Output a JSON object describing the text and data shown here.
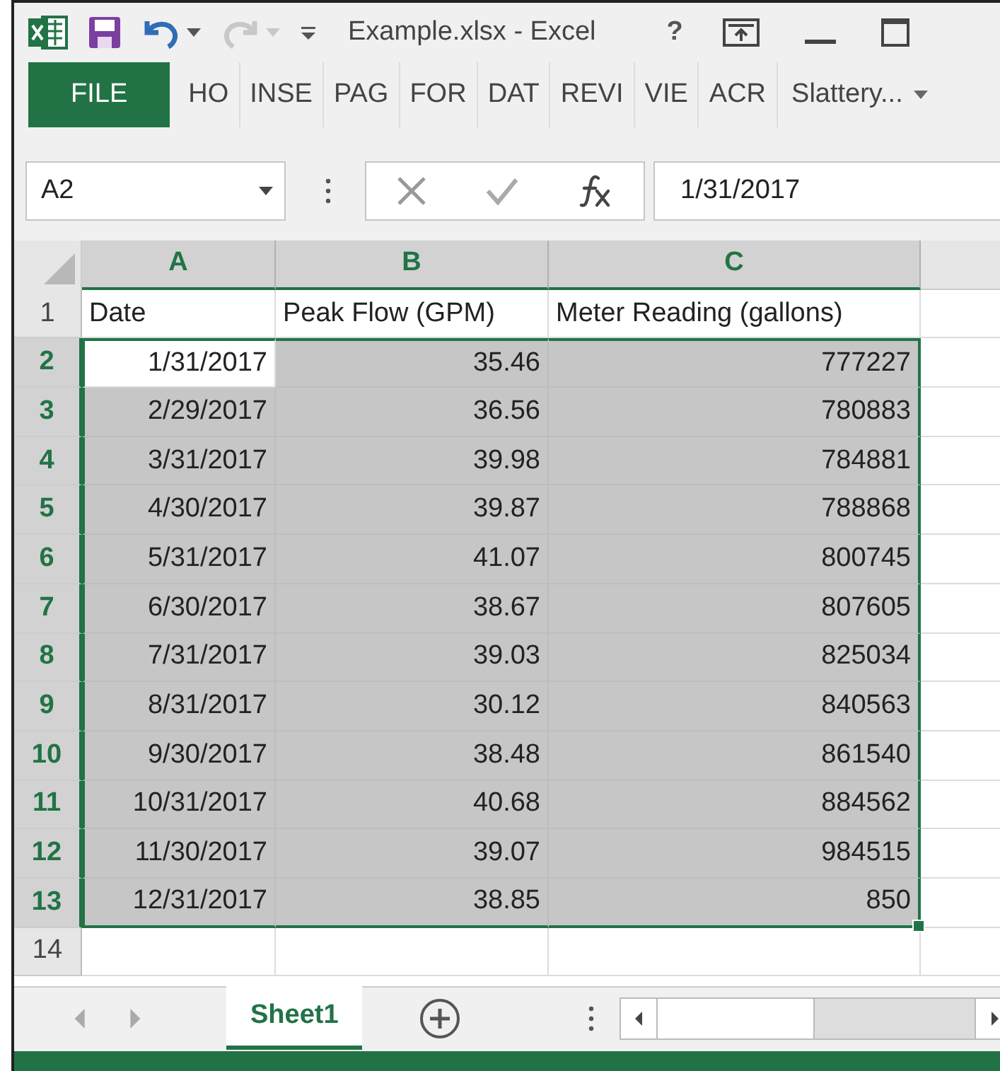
{
  "window": {
    "title": "Example.xlsx - Excel",
    "help": "?"
  },
  "ribbon_tabs": [
    {
      "label": "FILE",
      "selected": true
    },
    {
      "label": "HO",
      "selected": false
    },
    {
      "label": "INSE",
      "selected": false
    },
    {
      "label": "PAG",
      "selected": false
    },
    {
      "label": "FOR",
      "selected": false
    },
    {
      "label": "DAT",
      "selected": false
    },
    {
      "label": "REVI",
      "selected": false
    },
    {
      "label": "VIE",
      "selected": false
    },
    {
      "label": "ACR",
      "selected": false
    }
  ],
  "account": "Slattery...",
  "name_box": "A2",
  "formula": "1/31/2017",
  "columns": [
    {
      "label": "A",
      "selected": true
    },
    {
      "label": "B",
      "selected": true
    },
    {
      "label": "C",
      "selected": true
    }
  ],
  "rows": [
    {
      "number": "1",
      "selected": false,
      "active": false,
      "cells": [
        "Date",
        "Peak Flow (GPM)",
        "Meter Reading (gallons)"
      ]
    },
    {
      "number": "2",
      "selected": true,
      "active": true,
      "cells": [
        "1/31/2017",
        "35.46",
        "777227"
      ]
    },
    {
      "number": "3",
      "selected": true,
      "active": false,
      "cells": [
        "2/29/2017",
        "36.56",
        "780883"
      ]
    },
    {
      "number": "4",
      "selected": true,
      "active": false,
      "cells": [
        "3/31/2017",
        "39.98",
        "784881"
      ]
    },
    {
      "number": "5",
      "selected": true,
      "active": false,
      "cells": [
        "4/30/2017",
        "39.87",
        "788868"
      ]
    },
    {
      "number": "6",
      "selected": true,
      "active": false,
      "cells": [
        "5/31/2017",
        "41.07",
        "800745"
      ]
    },
    {
      "number": "7",
      "selected": true,
      "active": false,
      "cells": [
        "6/30/2017",
        "38.67",
        "807605"
      ]
    },
    {
      "number": "8",
      "selected": true,
      "active": false,
      "cells": [
        "7/31/2017",
        "39.03",
        "825034"
      ]
    },
    {
      "number": "9",
      "selected": true,
      "active": false,
      "cells": [
        "8/31/2017",
        "30.12",
        "840563"
      ]
    },
    {
      "number": "10",
      "selected": true,
      "active": false,
      "cells": [
        "9/30/2017",
        "38.48",
        "861540"
      ]
    },
    {
      "number": "11",
      "selected": true,
      "active": false,
      "cells": [
        "10/31/2017",
        "40.68",
        "884562"
      ]
    },
    {
      "number": "12",
      "selected": true,
      "active": false,
      "cells": [
        "11/30/2017",
        "39.07",
        "984515"
      ]
    },
    {
      "number": "13",
      "selected": true,
      "active": false,
      "cells": [
        "12/31/2017",
        "38.85",
        "850"
      ]
    },
    {
      "number": "14",
      "selected": false,
      "active": false,
      "cells": [
        "",
        "",
        ""
      ]
    }
  ],
  "sheet_tabs": [
    {
      "label": "Sheet1",
      "selected": true
    }
  ]
}
